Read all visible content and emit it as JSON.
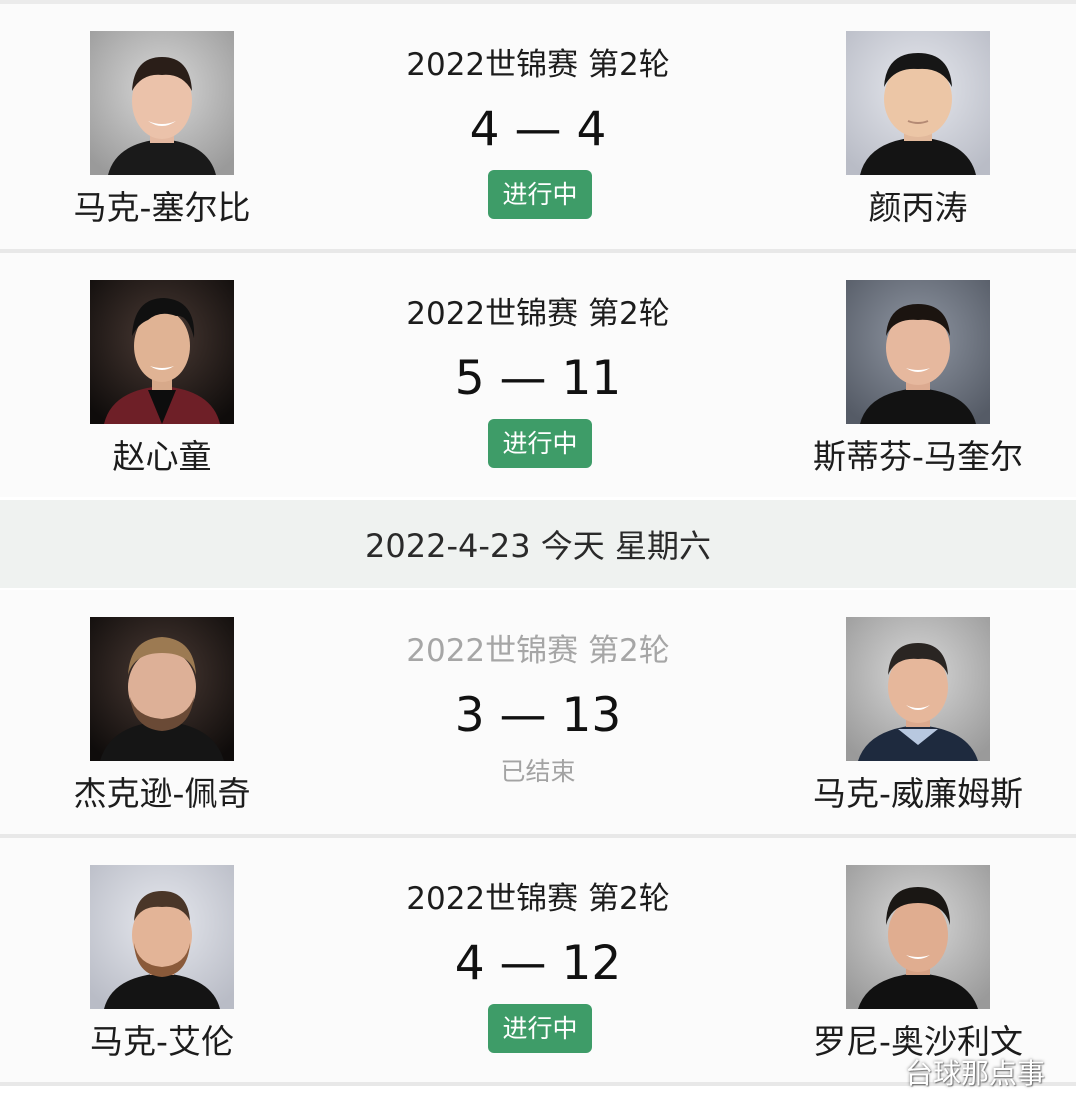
{
  "matches": [
    {
      "round": "2022世锦赛 第2轮",
      "score": "4 — 4",
      "status": "进行中",
      "home": {
        "name": "马克-塞尔比",
        "icon": "player-photo-icon"
      },
      "away": {
        "name": "颜丙涛",
        "icon": "player-photo-icon"
      }
    },
    {
      "round": "2022世锦赛 第2轮",
      "score": "5 — 11",
      "status": "进行中",
      "home": {
        "name": "赵心童",
        "icon": "player-photo-icon"
      },
      "away": {
        "name": "斯蒂芬-马奎尔",
        "icon": "player-photo-icon"
      }
    },
    {
      "round": "2022世锦赛 第2轮",
      "score": "3 — 13",
      "status": "已结束",
      "home": {
        "name": "杰克逊-佩奇",
        "icon": "player-photo-icon"
      },
      "away": {
        "name": "马克-威廉姆斯",
        "icon": "player-photo-icon"
      }
    },
    {
      "round": "2022世锦赛 第2轮",
      "score": "4 — 12",
      "status": "进行中",
      "home": {
        "name": "马克-艾伦",
        "icon": "player-photo-icon"
      },
      "away": {
        "name": "罗尼-奥沙利文",
        "icon": "player-photo-icon"
      }
    }
  ],
  "date_header": "2022-4-23 今天 星期六",
  "colors": {
    "live_badge": "#3e9c68",
    "ended_text": "#a3a3a3",
    "date_row_bg": "#eff2f0",
    "card_bg": "#fbfbfb"
  },
  "watermark": "台球那点事"
}
